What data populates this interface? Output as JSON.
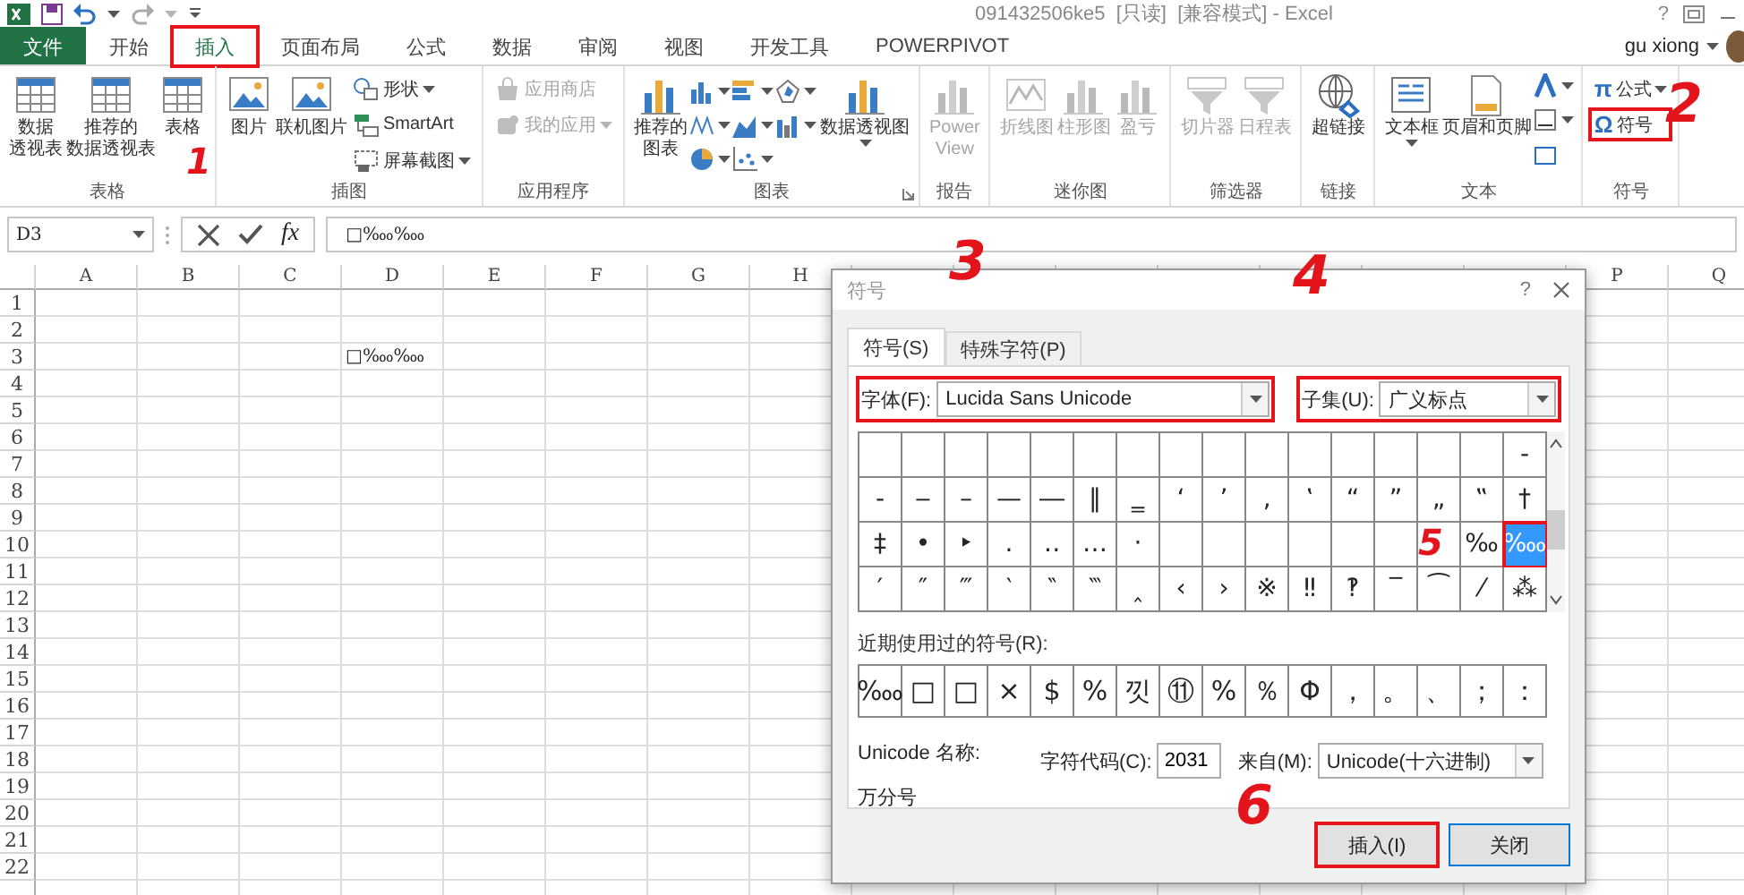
{
  "title_bar": {
    "title": "091432506ke5  [只读]  [兼容模式] - Excel",
    "help": "?"
  },
  "ribbon_tabs": [
    {
      "label": "文件",
      "kind": "file",
      "selected": false,
      "highlighted": false
    },
    {
      "label": "开始",
      "kind": "tab",
      "selected": false,
      "highlighted": false
    },
    {
      "label": "插入",
      "kind": "tab",
      "selected": true,
      "highlighted": true
    },
    {
      "label": "页面布局",
      "kind": "tab",
      "selected": false,
      "highlighted": false
    },
    {
      "label": "公式",
      "kind": "tab",
      "selected": false,
      "highlighted": false
    },
    {
      "label": "数据",
      "kind": "tab",
      "selected": false,
      "highlighted": false
    },
    {
      "label": "审阅",
      "kind": "tab",
      "selected": false,
      "highlighted": false
    },
    {
      "label": "视图",
      "kind": "tab",
      "selected": false,
      "highlighted": false
    },
    {
      "label": "开发工具",
      "kind": "tab",
      "selected": false,
      "highlighted": false
    },
    {
      "label": "POWERPIVOT",
      "kind": "tab",
      "selected": false,
      "highlighted": false
    }
  ],
  "user": {
    "name": "gu xiong"
  },
  "ribbon_groups": [
    {
      "label": "表格",
      "items": [
        {
          "kind": "large",
          "lines": [
            "数据",
            "透视表"
          ],
          "disabled": false,
          "dropdown": false
        },
        {
          "kind": "large",
          "lines": [
            "推荐的",
            "数据透视表"
          ],
          "disabled": false,
          "dropdown": false
        },
        {
          "kind": "large",
          "label": "表格",
          "disabled": false,
          "dropdown": false
        }
      ]
    },
    {
      "label": "插图",
      "items": [
        {
          "kind": "large",
          "label": "图片",
          "disabled": false,
          "dropdown": false
        },
        {
          "kind": "large",
          "label": "联机图片",
          "disabled": false,
          "dropdown": false
        },
        {
          "kind": "stack",
          "entries": [
            {
              "label": "形状",
              "disabled": false,
              "dropdown": true,
              "highlighted": false
            },
            {
              "label": "SmartArt",
              "disabled": false,
              "dropdown": false,
              "highlighted": false
            },
            {
              "label": "屏幕截图",
              "disabled": false,
              "dropdown": true,
              "highlighted": false
            }
          ]
        }
      ]
    },
    {
      "label": "应用程序",
      "items": [
        {
          "kind": "stack",
          "entries": [
            {
              "label": "应用商店",
              "disabled": true,
              "dropdown": false,
              "highlighted": false
            },
            {
              "label": "我的应用",
              "disabled": true,
              "dropdown": true,
              "highlighted": false
            }
          ]
        }
      ]
    },
    {
      "label": "图表",
      "items": [
        {
          "kind": "large",
          "lines": [
            "推荐的",
            "图表"
          ],
          "disabled": false,
          "dropdown": false
        },
        {
          "kind": "chart-icons"
        },
        {
          "kind": "large",
          "label": "数据透视图",
          "disabled": false,
          "dropdown": true
        }
      ]
    },
    {
      "label": "报告",
      "items": [
        {
          "kind": "large",
          "lines": [
            "Power",
            "View"
          ],
          "disabled": true,
          "dropdown": false
        }
      ]
    },
    {
      "label": "迷你图",
      "items": [
        {
          "kind": "large",
          "label": "折线图",
          "disabled": true,
          "dropdown": false
        },
        {
          "kind": "large",
          "label": "柱形图",
          "disabled": true,
          "dropdown": false
        },
        {
          "kind": "large",
          "label": "盈亏",
          "disabled": true,
          "dropdown": false
        }
      ]
    },
    {
      "label": "筛选器",
      "items": [
        {
          "kind": "large",
          "label": "切片器",
          "disabled": true,
          "dropdown": false
        },
        {
          "kind": "large",
          "label": "日程表",
          "disabled": true,
          "dropdown": false
        }
      ]
    },
    {
      "label": "链接",
      "items": [
        {
          "kind": "large",
          "label": "超链接",
          "disabled": false,
          "dropdown": false
        }
      ]
    },
    {
      "label": "文本",
      "items": [
        {
          "kind": "large",
          "label": "文本框",
          "disabled": false,
          "dropdown": true
        },
        {
          "kind": "large",
          "label": "页眉和页脚",
          "disabled": false,
          "dropdown": false
        },
        {
          "kind": "text-icons"
        }
      ]
    },
    {
      "label": "符号",
      "items": [
        {
          "kind": "stack",
          "entries": [
            {
              "glyph": "π",
              "label": "公式",
              "disabled": false,
              "dropdown": true,
              "highlighted": false
            },
            {
              "glyph": "Ω",
              "label": "符号",
              "disabled": false,
              "dropdown": false,
              "highlighted": true
            }
          ]
        }
      ]
    }
  ],
  "formula_bar": {
    "name_box": "D3",
    "fx": "fx",
    "formula": "□‱‱"
  },
  "sheet": {
    "columns": [
      "A",
      "B",
      "C",
      "D",
      "E",
      "F",
      "G",
      "H",
      "P",
      "Q"
    ],
    "rows": [
      {
        "header": "1"
      },
      {
        "header": "2"
      },
      {
        "header": "3",
        "cells": [
          null,
          null,
          null,
          "□‱‱"
        ]
      },
      {
        "header": "4"
      },
      {
        "header": "5"
      },
      {
        "header": "6"
      },
      {
        "header": "7"
      },
      {
        "header": "8"
      },
      {
        "header": "9"
      },
      {
        "header": "10"
      },
      {
        "header": "11"
      },
      {
        "header": "12"
      },
      {
        "header": "13"
      },
      {
        "header": "14"
      },
      {
        "header": "15"
      },
      {
        "header": "16"
      },
      {
        "header": "17"
      },
      {
        "header": "18"
      },
      {
        "header": "19"
      },
      {
        "header": "20"
      },
      {
        "header": "21"
      },
      {
        "header": "22"
      }
    ]
  },
  "symbol_dialog": {
    "title": "符号",
    "help": "?",
    "tabs": [
      {
        "label": "符号(S)",
        "selected": true
      },
      {
        "label": "特殊字符(P)",
        "selected": false
      }
    ],
    "font": {
      "label": "字体(F):",
      "value": "Lucida Sans Unicode",
      "highlighted": true
    },
    "subset": {
      "label": "子集(U):",
      "value": "广义标点",
      "highlighted": true
    },
    "symbols": [
      {
        "selected": false
      },
      {
        "selected": false
      },
      {
        "selected": false
      },
      {
        "selected": false
      },
      {
        "selected": false
      },
      {
        "selected": false
      },
      {
        "selected": false
      },
      {
        "selected": false
      },
      {
        "selected": false
      },
      {
        "selected": false
      },
      {
        "selected": false
      },
      {
        "selected": false
      },
      {
        "selected": false
      },
      {
        "selected": false
      },
      {
        "selected": false
      },
      {
        "char": "‐",
        "selected": false
      },
      {
        "char": "‑",
        "selected": false
      },
      {
        "char": "‒",
        "selected": false
      },
      {
        "char": "–",
        "selected": false
      },
      {
        "char": "—",
        "selected": false
      },
      {
        "char": "―",
        "selected": false
      },
      {
        "char": "‖",
        "selected": false
      },
      {
        "char": "‗",
        "selected": false
      },
      {
        "char": "‘",
        "selected": false
      },
      {
        "char": "’",
        "selected": false
      },
      {
        "char": "‚",
        "selected": false
      },
      {
        "char": "‛",
        "selected": false
      },
      {
        "char": "“",
        "selected": false
      },
      {
        "char": "”",
        "selected": false
      },
      {
        "char": "„",
        "selected": false
      },
      {
        "char": "‟",
        "selected": false
      },
      {
        "char": "†",
        "selected": false
      },
      {
        "char": "‡",
        "selected": false
      },
      {
        "char": "•",
        "selected": false
      },
      {
        "char": "‣",
        "selected": false
      },
      {
        "char": "․",
        "selected": false
      },
      {
        "char": "‥",
        "selected": false
      },
      {
        "char": "…",
        "selected": false
      },
      {
        "char": "‧",
        "selected": false
      },
      {
        "selected": false
      },
      {
        "selected": false
      },
      {
        "selected": false
      },
      {
        "selected": false
      },
      {
        "selected": false
      },
      {
        "selected": false
      },
      {
        "selected": false
      },
      {
        "char": "‰",
        "selected": false
      },
      {
        "char": "‱",
        "selected": true,
        "highlighted": true
      },
      {
        "char": "′",
        "selected": false
      },
      {
        "char": "″",
        "selected": false
      },
      {
        "char": "‴",
        "selected": false
      },
      {
        "char": "‵",
        "selected": false
      },
      {
        "char": "‶",
        "selected": false
      },
      {
        "char": "‷",
        "selected": false
      },
      {
        "char": "‸",
        "selected": false
      },
      {
        "char": "‹",
        "selected": false
      },
      {
        "char": "›",
        "selected": false
      },
      {
        "char": "※",
        "selected": false
      },
      {
        "char": "‼",
        "selected": false
      },
      {
        "char": "‽",
        "selected": false
      },
      {
        "char": "‾",
        "selected": false
      },
      {
        "char": "⁀",
        "selected": false
      },
      {
        "char": "⁄",
        "selected": false
      },
      {
        "char": "⁂",
        "selected": false
      }
    ],
    "recent_label": "近期使用过的符号(R):",
    "recent": [
      "‱",
      "□",
      "□",
      "×",
      "$",
      "%",
      "낏",
      "⑪",
      "%",
      "％",
      "Φ",
      "，",
      "。",
      "、",
      "；",
      "："
    ],
    "unicode_name_label": "Unicode 名称:",
    "unicode_name": "万分号",
    "code_label": "字符代码(C):",
    "code": "2031",
    "from_label": "来自(M):",
    "from": "Unicode(十六进制)",
    "buttons": [
      {
        "label": "插入(I)",
        "highlighted": true,
        "default": false
      },
      {
        "label": "关闭",
        "highlighted": false,
        "default": true
      }
    ]
  },
  "annotations": [
    {
      "label": "1"
    },
    {
      "label": "2"
    },
    {
      "label": "3"
    },
    {
      "label": "4"
    },
    {
      "label": "5"
    },
    {
      "label": "6"
    }
  ]
}
